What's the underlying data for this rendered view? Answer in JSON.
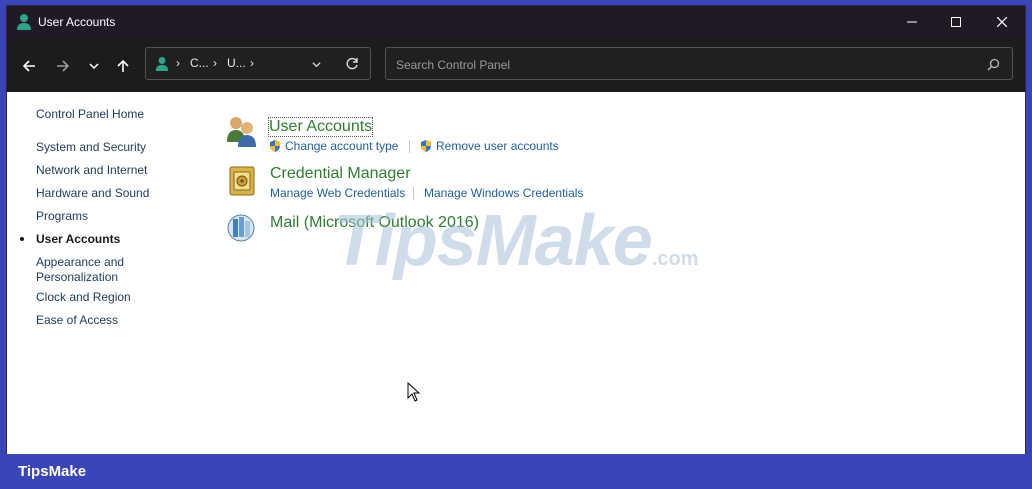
{
  "window": {
    "title": "User Accounts",
    "minimize_icon": "minimize-icon",
    "maximize_icon": "maximize-icon",
    "close_icon": "close-icon"
  },
  "toolbar": {
    "breadcrumb": [
      "C...",
      "U..."
    ],
    "search_placeholder": "Search Control Panel"
  },
  "sidebar": {
    "items": [
      {
        "label": "Control Panel Home"
      },
      {
        "label": "System and Security"
      },
      {
        "label": "Network and Internet"
      },
      {
        "label": "Hardware and Sound"
      },
      {
        "label": "Programs"
      },
      {
        "label": "User Accounts",
        "active": true
      },
      {
        "label": "Appearance and"
      },
      {
        "label": "Personalization"
      },
      {
        "label": "Clock and Region"
      },
      {
        "label": "Ease of Access"
      }
    ]
  },
  "categories": [
    {
      "title": "User Accounts",
      "links": [
        "Change account type",
        "Remove user accounts"
      ]
    },
    {
      "title": "Credential Manager",
      "links": [
        "Manage Web Credentials",
        "Manage Windows Credentials"
      ]
    },
    {
      "title": "Mail (Microsoft Outlook 2016)",
      "links": []
    }
  ],
  "watermark": {
    "main": "TipsMake",
    "suffix": ".com"
  },
  "footer": {
    "brand": "TipsMake"
  },
  "colors": {
    "accent_green": "#2e7d32",
    "link_blue": "#1f5e9e",
    "titlebar": "#1f1a26",
    "frame": "#3a45b8"
  }
}
